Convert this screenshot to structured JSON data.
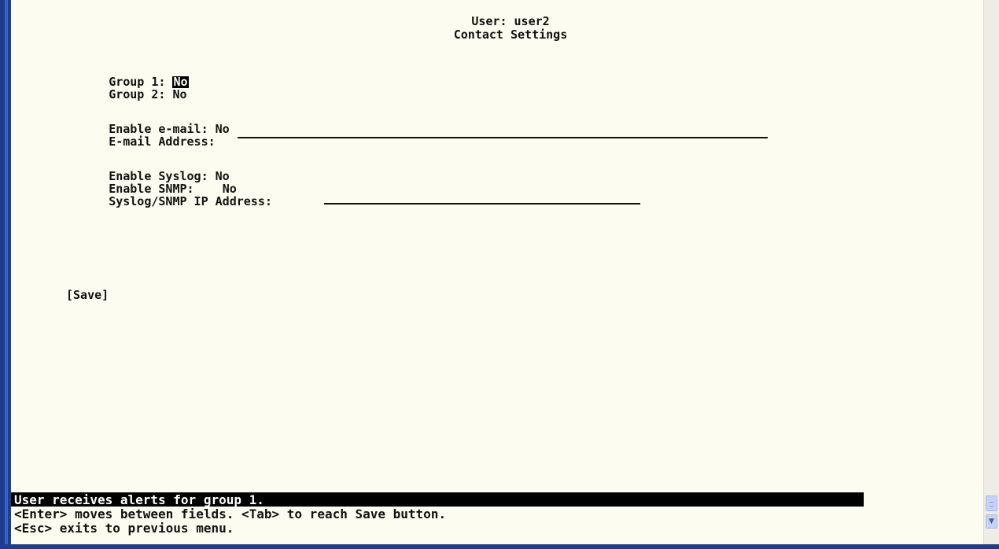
{
  "header": {
    "user_line": "User: user2",
    "title": "Contact Settings"
  },
  "groups": {
    "group1_label": "Group 1: ",
    "group1_value": "No",
    "group2_label": "Group 2: ",
    "group2_value": "No"
  },
  "email": {
    "enable_label": "Enable e-mail: ",
    "enable_value": "No",
    "address_label": "E-mail Address: ",
    "address_value": ""
  },
  "syslog": {
    "enable_syslog_label": "Enable Syslog: ",
    "enable_syslog_value": "No",
    "enable_snmp_label": "Enable SNMP:    ",
    "enable_snmp_value": "No",
    "ip_label": "Syslog/SNMP IP Address: ",
    "ip_value": ""
  },
  "actions": {
    "save_label": "[Save]"
  },
  "status": {
    "message": "User receives alerts for group 1.",
    "help_line1": "<Enter> moves between fields. <Tab> to reach Save button.",
    "help_line2": "<Esc> exits to previous menu."
  },
  "scrollbar": {
    "down_icon": "chevron-down-icon",
    "grip_icon": "grip-icon"
  },
  "colors": {
    "background": "#fcfcf0",
    "text": "#111111",
    "highlight_bg": "#000000",
    "highlight_fg": "#ffffff",
    "frame": "#1f3d8e"
  }
}
